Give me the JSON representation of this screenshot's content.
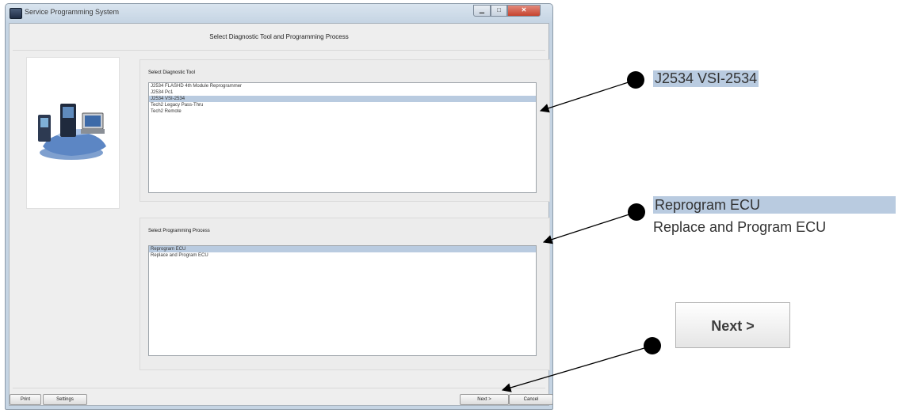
{
  "window": {
    "title": "Service Programming System",
    "minimize_glyph": "▁",
    "maximize_glyph": "□",
    "close_glyph": "✕"
  },
  "page": {
    "title": "Select Diagnostic Tool and Programming Process"
  },
  "diagnostic_tool": {
    "label": "Select Diagnostic Tool",
    "items": [
      "J2534 FLASHD 4th Module Reprogrammer",
      "J2534 Pc1",
      "J2534 VSI-2534",
      "Tech2 Legacy Pass-Thru",
      "Tech2 Remote"
    ],
    "selected_index": 2
  },
  "programming_process": {
    "label": "Select Programming Process",
    "items": [
      "Reprogram ECU",
      "Replace and Program ECU"
    ],
    "selected_index": 0
  },
  "buttons": {
    "print": "Print",
    "settings": "Settings",
    "next": "Next >",
    "cancel": "Cancel"
  },
  "callouts": {
    "tool": "J2534 VSI-2534",
    "process_selected": "Reprogram ECU",
    "process_other": "Replace and Program ECU",
    "next_button": "Next >"
  },
  "colors": {
    "selection": "#b9cbe0",
    "window_frame": "#c5d4e3",
    "close_button": "#c6432e"
  }
}
